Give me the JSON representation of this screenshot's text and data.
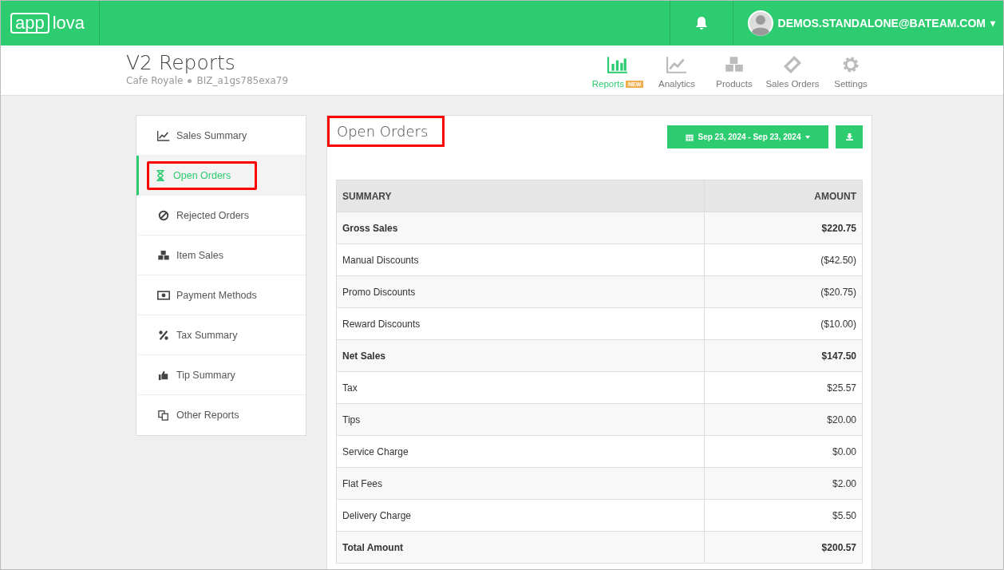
{
  "brand": {
    "logo_left": "app",
    "logo_right": "lova"
  },
  "user": {
    "email": "DEMOS.STANDALONE@BATEAM.COM",
    "caret": "▾"
  },
  "page": {
    "title": "V2 Reports",
    "business": "Cafe Royale",
    "business_id": "BIZ_a1gs785exa79"
  },
  "nav": [
    {
      "label": "Reports",
      "kind": "reports",
      "badge": "NEW",
      "selected": true
    },
    {
      "label": "Analytics",
      "kind": "analytics",
      "selected": false
    },
    {
      "label": "Products",
      "kind": "products",
      "selected": false
    },
    {
      "label": "Sales Orders",
      "kind": "orders",
      "selected": false
    },
    {
      "label": "Settings",
      "kind": "settings",
      "selected": false
    }
  ],
  "sidebar": {
    "items": [
      {
        "label": "Sales Summary",
        "kind": "summary",
        "selected": false,
        "highlighted": false
      },
      {
        "label": "Open Orders",
        "kind": "open",
        "selected": true,
        "highlighted": true
      },
      {
        "label": "Rejected Orders",
        "kind": "rejected",
        "selected": false,
        "highlighted": false
      },
      {
        "label": "Item Sales",
        "kind": "items",
        "selected": false,
        "highlighted": false
      },
      {
        "label": "Payment Methods",
        "kind": "payment",
        "selected": false,
        "highlighted": false
      },
      {
        "label": "Tax Summary",
        "kind": "tax",
        "selected": false,
        "highlighted": false
      },
      {
        "label": "Tip Summary",
        "kind": "tip",
        "selected": false,
        "highlighted": false
      },
      {
        "label": "Other Reports",
        "kind": "other",
        "selected": false,
        "highlighted": false
      }
    ]
  },
  "report": {
    "title": "Open Orders",
    "title_highlighted": true,
    "date_range": "Sep 23, 2024 - Sep 23, 2024",
    "table": {
      "columns": [
        "SUMMARY",
        "AMOUNT"
      ],
      "rows": [
        {
          "kind": "total",
          "label": "Gross Sales",
          "amount": "$220.75"
        },
        {
          "kind": "item",
          "label": "Manual Discounts",
          "amount": "($42.50)"
        },
        {
          "kind": "item",
          "label": "Promo Discounts",
          "amount": "($20.75)"
        },
        {
          "kind": "item",
          "label": "Reward Discounts",
          "amount": "($10.00)"
        },
        {
          "kind": "total",
          "label": "Net Sales",
          "amount": "$147.50"
        },
        {
          "kind": "item",
          "label": "Tax",
          "amount": "$25.57"
        },
        {
          "kind": "item",
          "label": "Tips",
          "amount": "$20.00"
        },
        {
          "kind": "item",
          "label": "Service Charge",
          "amount": "$0.00"
        },
        {
          "kind": "item",
          "label": "Flat Fees",
          "amount": "$2.00"
        },
        {
          "kind": "item",
          "label": "Delivery Charge",
          "amount": "$5.50"
        },
        {
          "kind": "total",
          "label": "Total Amount",
          "amount": "$200.57"
        }
      ]
    }
  }
}
